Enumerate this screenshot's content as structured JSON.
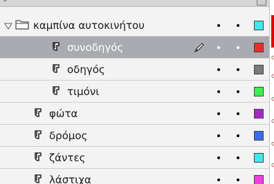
{
  "layers_panel": {
    "folder": {
      "name": "καμπίνα αυτοκινήτου",
      "expanded": true,
      "outline_color": "#3fe8ee"
    },
    "layers": [
      {
        "name": "συνοδηγός",
        "nested": true,
        "selected": true,
        "editing": true,
        "outline_color": "#ee2b2b"
      },
      {
        "name": "οδηγός",
        "nested": true,
        "selected": false,
        "editing": false,
        "outline_color": "#7a7a7a"
      },
      {
        "name": "τιμόνι",
        "nested": true,
        "selected": false,
        "editing": false,
        "outline_color": "#3df04a"
      },
      {
        "name": "φώτα",
        "nested": false,
        "selected": false,
        "editing": false,
        "outline_color": "#a526c9"
      },
      {
        "name": "δρόμος",
        "nested": false,
        "selected": false,
        "editing": false,
        "outline_color": "#3a6de8"
      },
      {
        "name": "ζάντες",
        "nested": false,
        "selected": false,
        "editing": false,
        "outline_color": "#3fe8ee"
      },
      {
        "name": "λάστιχα",
        "nested": false,
        "selected": false,
        "editing": false,
        "outline_color": "#ee3fe0"
      }
    ]
  }
}
